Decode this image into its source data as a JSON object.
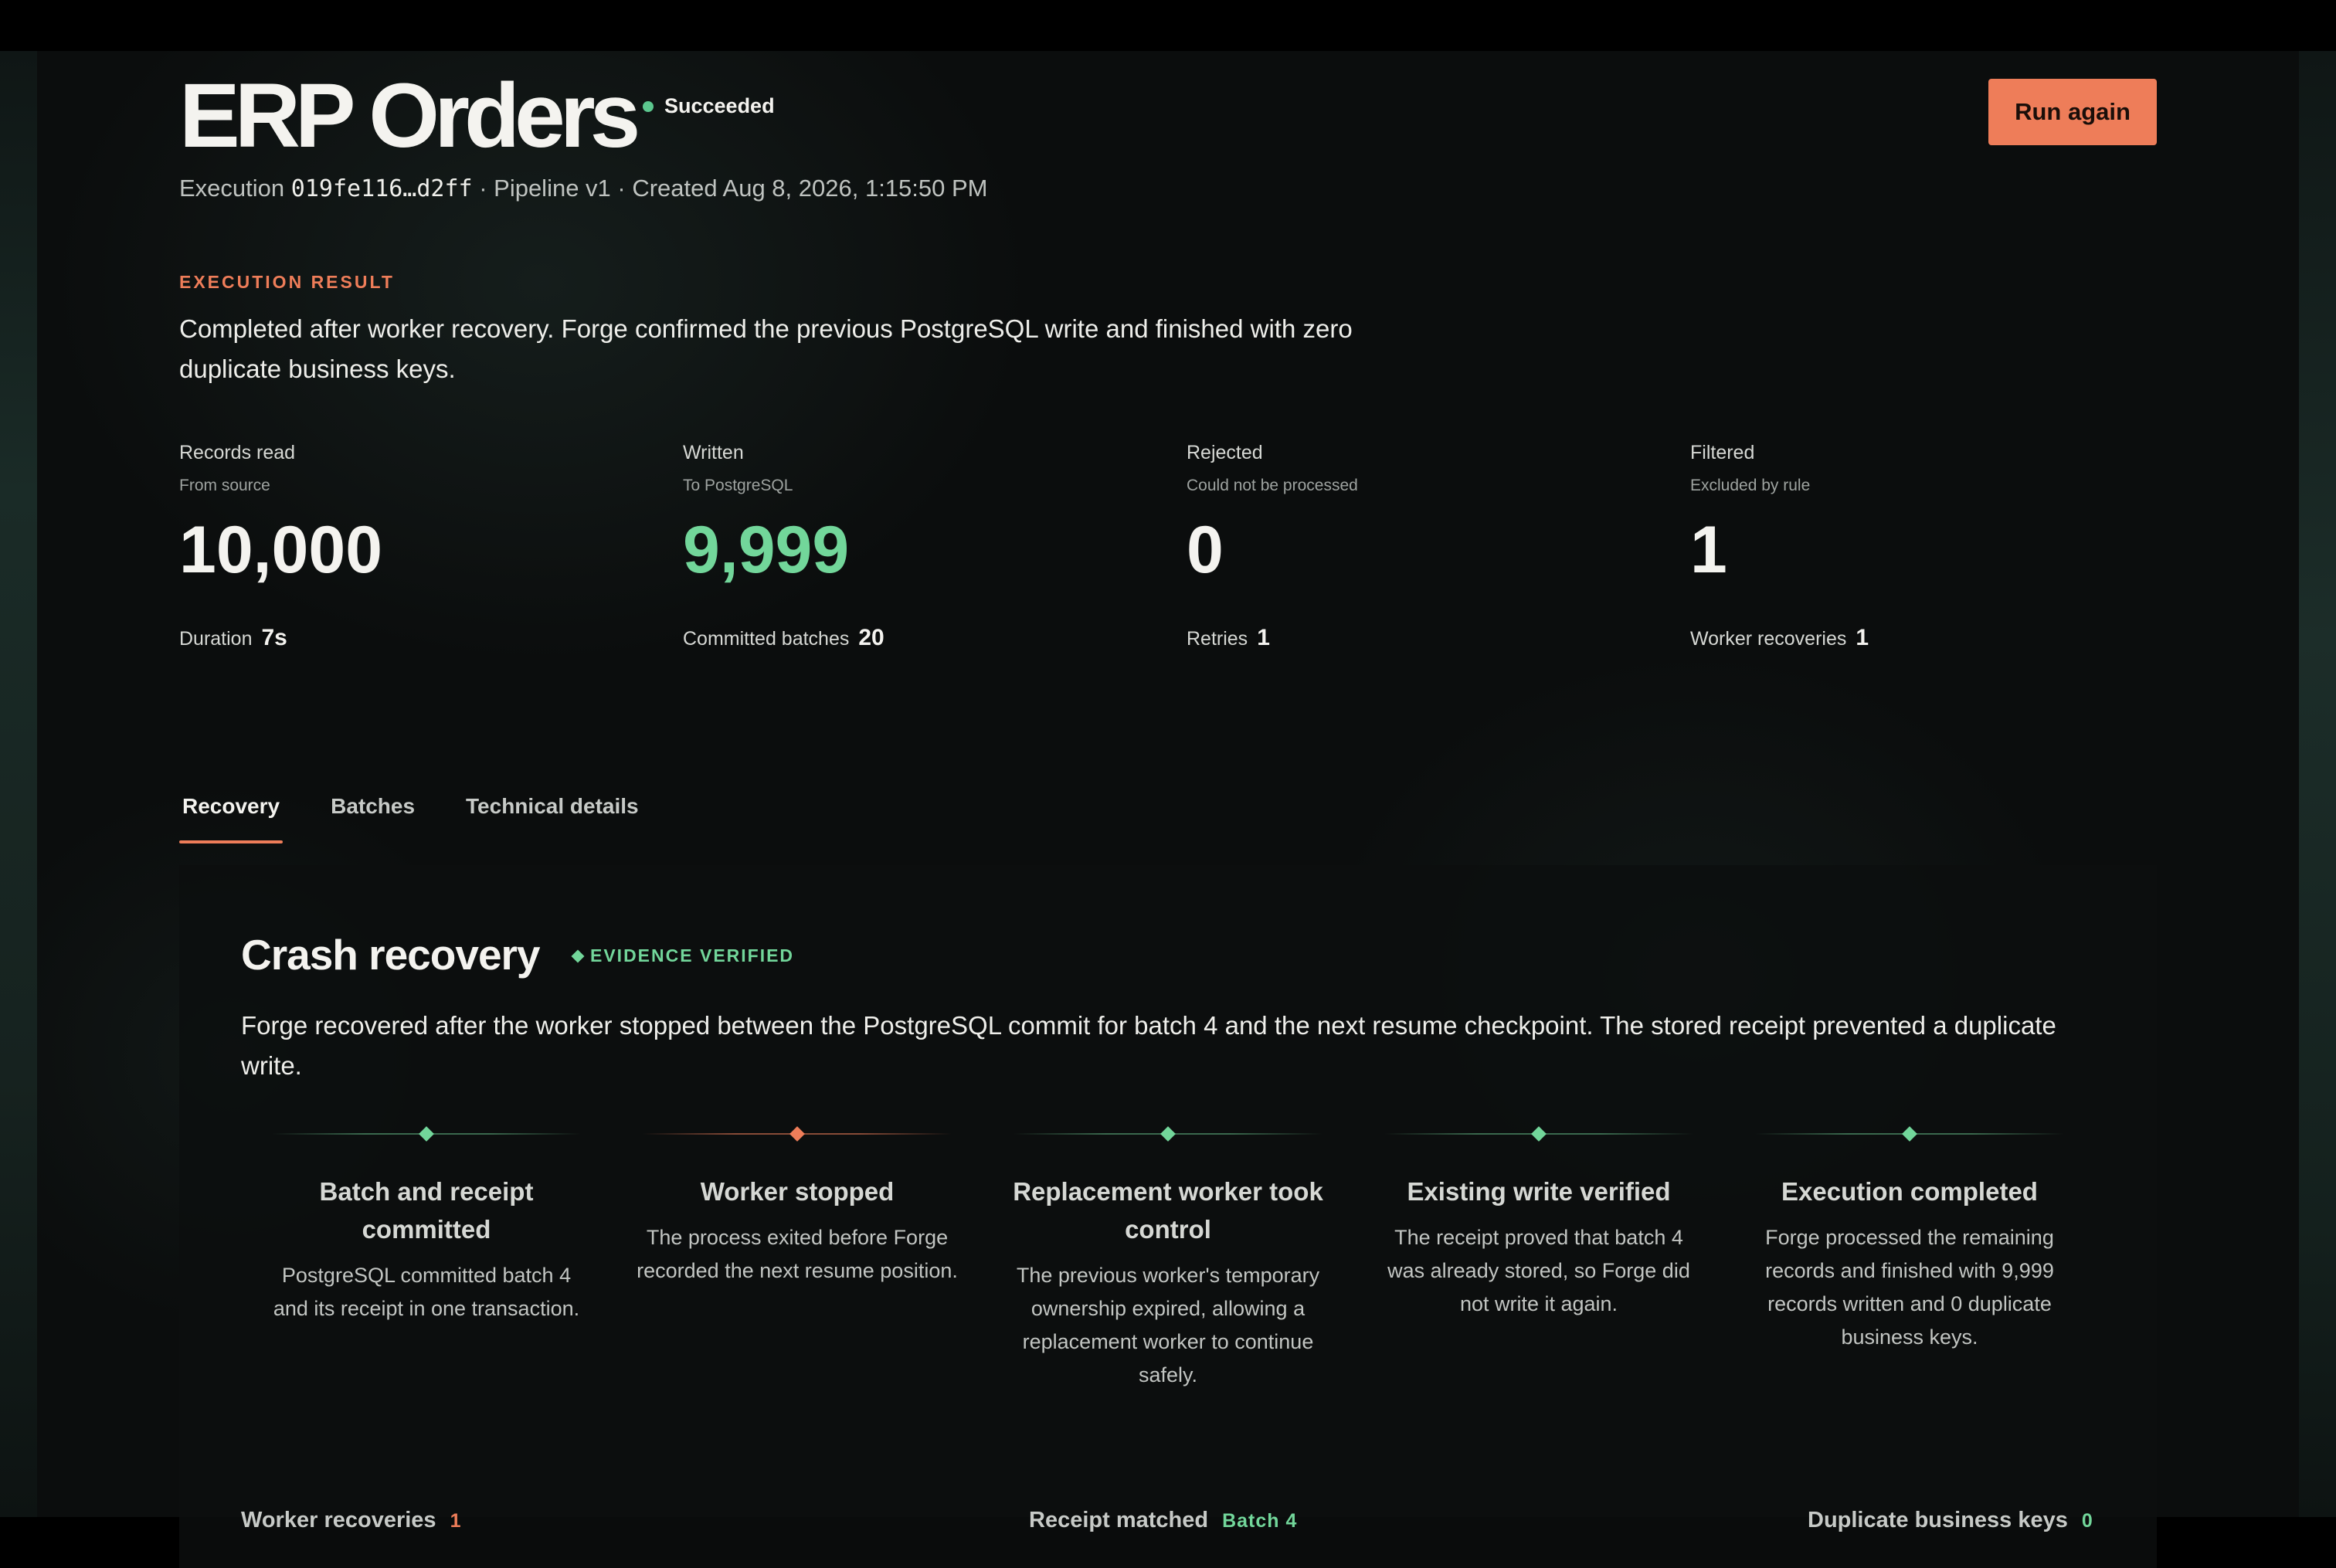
{
  "header": {
    "title": "ERP Orders",
    "status": "Succeeded",
    "run_again_label": "Run again",
    "meta_prefix": "Execution",
    "execution_id": "019fe116…d2ff",
    "meta_suffix": "· Pipeline v1 · Created Aug 8, 2026, 1:15:50 PM"
  },
  "result": {
    "label": "EXECUTION RESULT",
    "text": "Completed after worker recovery. Forge confirmed the previous PostgreSQL write and finished with zero duplicate business keys."
  },
  "stats": [
    {
      "label": "Records read",
      "sub": "From source",
      "value": "10,000",
      "foot_label": "Duration",
      "foot_value": "7s"
    },
    {
      "label": "Written",
      "sub": "To PostgreSQL",
      "value": "9,999",
      "foot_label": "Committed batches",
      "foot_value": "20"
    },
    {
      "label": "Rejected",
      "sub": "Could not be processed",
      "value": "0",
      "foot_label": "Retries",
      "foot_value": "1"
    },
    {
      "label": "Filtered",
      "sub": "Excluded by rule",
      "value": "1",
      "foot_label": "Worker recoveries",
      "foot_value": "1"
    }
  ],
  "tabs": [
    {
      "label": "Recovery",
      "active": true
    },
    {
      "label": "Batches",
      "active": false
    },
    {
      "label": "Technical details",
      "active": false
    }
  ],
  "recovery": {
    "title": "Crash recovery",
    "badge": "EVIDENCE VERIFIED",
    "description": "Forge recovered after the worker stopped between the PostgreSQL commit for batch 4 and the next resume checkpoint. The stored receipt prevented a duplicate write.",
    "steps": [
      {
        "title": "Batch and receipt committed",
        "text": "PostgreSQL committed batch 4 and its receipt in one transaction.",
        "state": "ok"
      },
      {
        "title": "Worker stopped",
        "text": "The process exited before Forge recorded the next resume position.",
        "state": "warning"
      },
      {
        "title": "Replacement worker took control",
        "text": "The previous worker's temporary ownership expired, allowing a replacement worker to continue safely.",
        "state": "ok"
      },
      {
        "title": "Existing write verified",
        "text": "The receipt proved that batch 4 was already stored, so Forge did not write it again.",
        "state": "ok"
      },
      {
        "title": "Execution completed",
        "text": "Forge processed the remaining records and finished with 9,999 records written and 0 duplicate business keys.",
        "state": "ok"
      }
    ],
    "footer": {
      "worker_recoveries_label": "Worker recoveries",
      "worker_recoveries_value": "1",
      "receipt_label": "Receipt matched",
      "receipt_value": "Batch 4",
      "duplicates_label": "Duplicate business keys",
      "duplicates_value": "0"
    }
  },
  "colors": {
    "accent": "#ee7d59",
    "success": "#72d69a",
    "background": "#0b0d0d"
  }
}
